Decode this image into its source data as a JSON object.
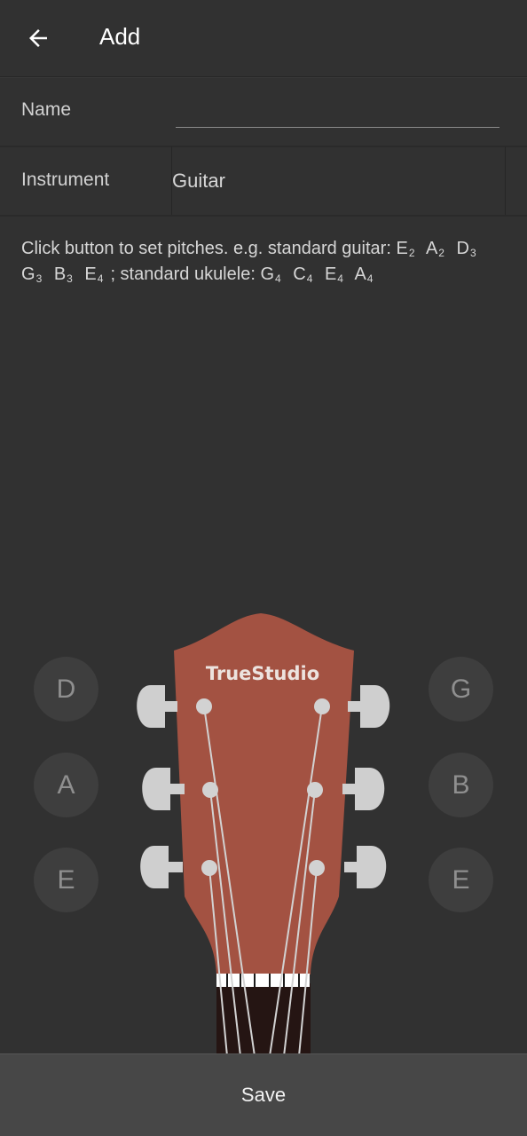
{
  "header": {
    "title": "Add"
  },
  "form": {
    "name_label": "Name",
    "name_value": "",
    "instrument_label": "Instrument",
    "instrument_value": "Guitar"
  },
  "hint": {
    "text": "Click button to set pitches. e.g. standard guitar:",
    "guitar": [
      {
        "n": "E",
        "o": "2"
      },
      {
        "n": "A",
        "o": "2"
      },
      {
        "n": "D",
        "o": "3"
      },
      {
        "n": "G",
        "o": "3"
      },
      {
        "n": "B",
        "o": "3"
      },
      {
        "n": "E",
        "o": "4"
      }
    ],
    "sep": "; standard ukulele:",
    "ukulele": [
      {
        "n": "G",
        "o": "4"
      },
      {
        "n": "C",
        "o": "4"
      },
      {
        "n": "E",
        "o": "4"
      },
      {
        "n": "A",
        "o": "4"
      }
    ]
  },
  "pitches": {
    "left": [
      "D",
      "A",
      "E"
    ],
    "right": [
      "G",
      "B",
      "E"
    ]
  },
  "brand": "TrueStudio",
  "colors": {
    "background": "#313131",
    "headstock": "#a35242",
    "button": "#3e3e3e",
    "save_bar": "#474747"
  },
  "footer": {
    "save_label": "Save"
  }
}
